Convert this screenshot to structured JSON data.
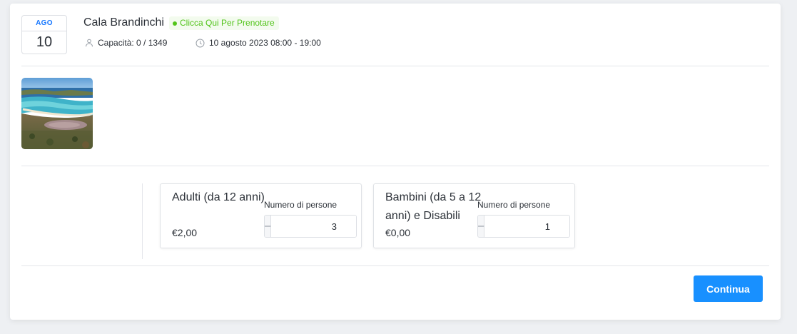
{
  "event": {
    "date": {
      "month": "AGO",
      "day": "10"
    },
    "title": "Cala Brandinchi",
    "status_badge": "Clicca Qui Per Prenotare",
    "capacity": "Capacità: 0 / 1349",
    "datetime": "10 agosto 2023 08:00 - 19:00",
    "icons": {
      "capacity": "user-icon",
      "time": "clock-icon"
    }
  },
  "tickets": [
    {
      "name": "Adulti (da 12 anni)",
      "price": "€2,00",
      "quantity_label": "Numero di persone",
      "quantity": "3",
      "minus": "–",
      "plus": "+"
    },
    {
      "name": "Bambini (da 5 a 12 anni) e Disabili",
      "price": "€0,00",
      "quantity_label": "Numero di persone",
      "quantity": "1",
      "minus": "–",
      "plus": "+"
    }
  ],
  "actions": {
    "continue_label": "Continua"
  },
  "colors": {
    "accent": "#1890ff",
    "month": "#1677ff",
    "status": "#52c41a",
    "status_bg": "#f3fbee"
  }
}
